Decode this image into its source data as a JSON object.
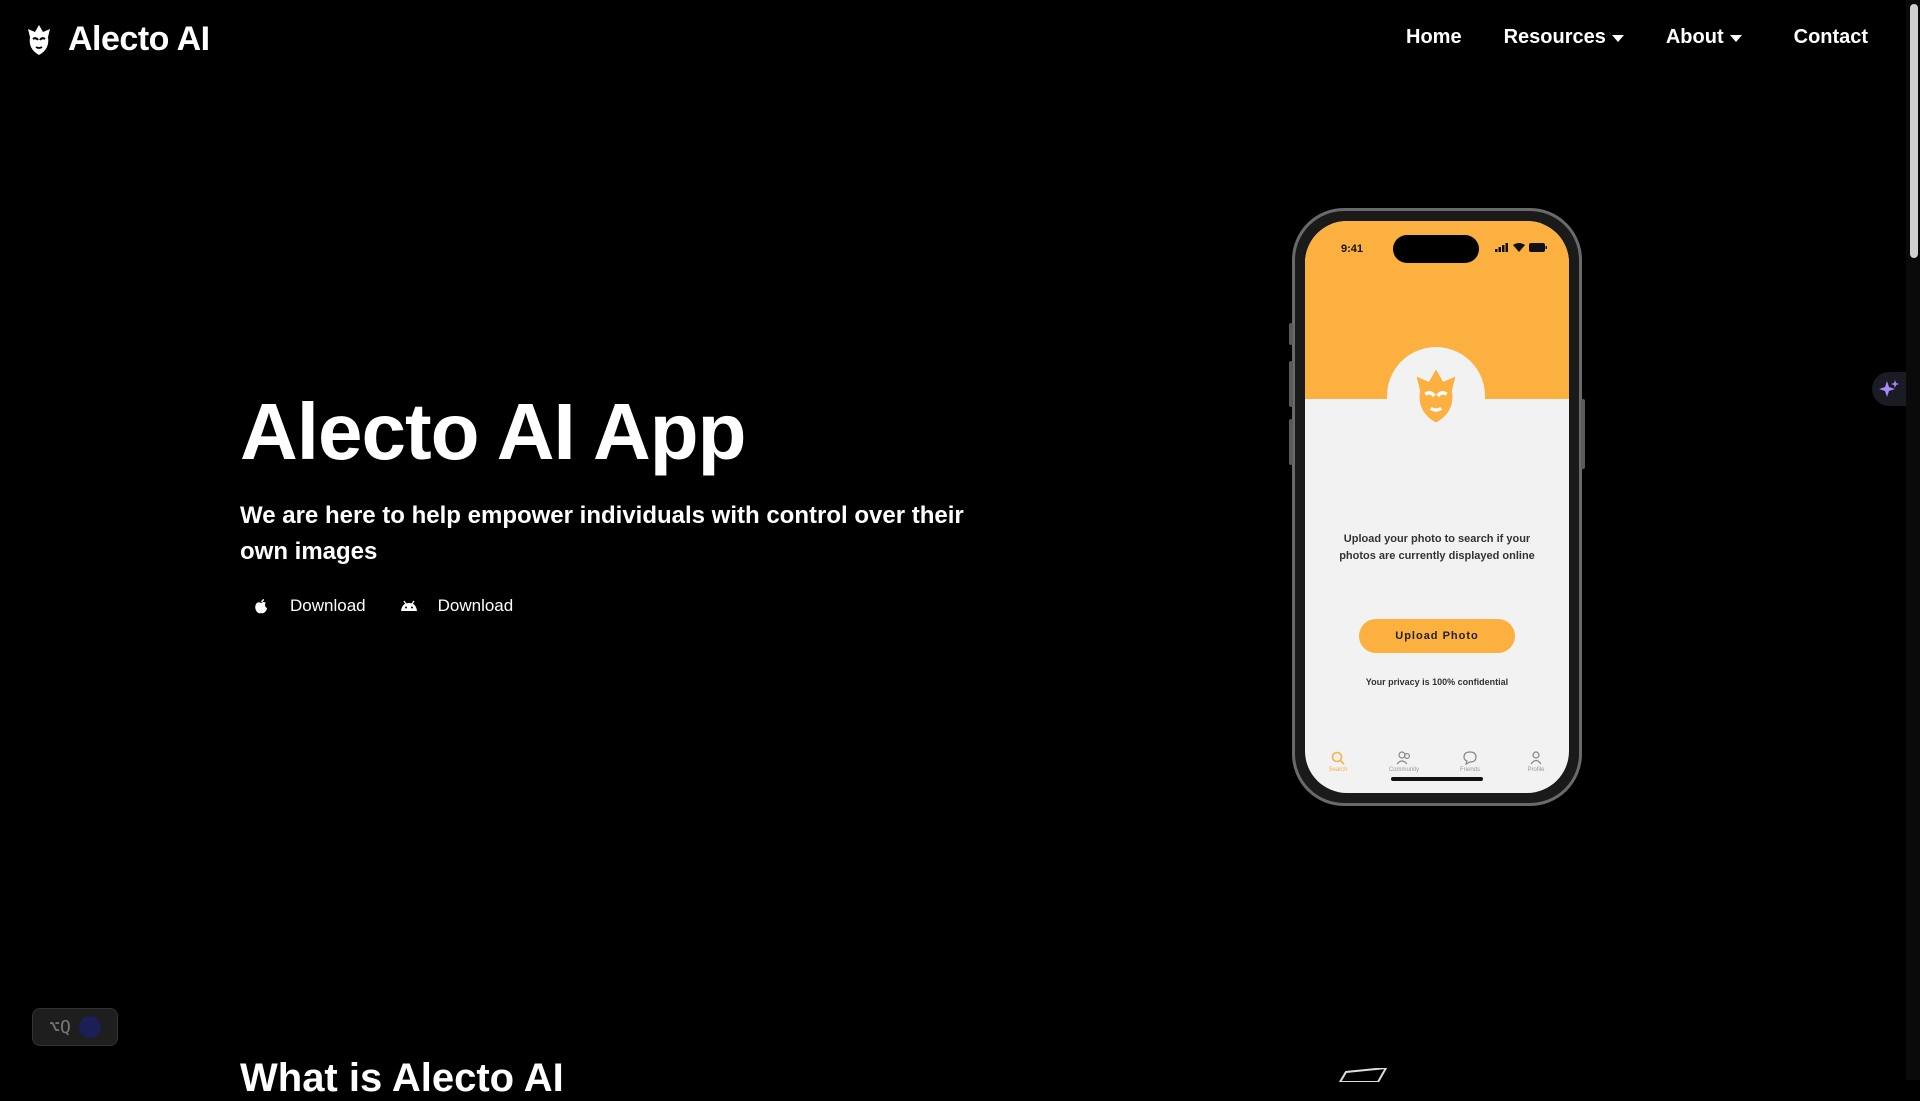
{
  "brand": {
    "name": "Alecto AI",
    "logo_icon": "alecto-face-logo-icon"
  },
  "nav": {
    "home": "Home",
    "resources": "Resources",
    "about": "About",
    "contact": "Contact"
  },
  "hero": {
    "title": "Alecto AI App",
    "subtitle": "We are here to help empower individuals with control over their own images",
    "downloads": [
      {
        "label": "Download",
        "icon": "apple-icon"
      },
      {
        "label": "Download",
        "icon": "android-icon"
      }
    ]
  },
  "phone": {
    "status_time": "9:41",
    "description": "Upload your photo to search if your photos are currently displayed online",
    "upload_button": "Upload Photo",
    "privacy_note": "Your privacy is 100% confidential",
    "tabs": [
      {
        "label": "Search",
        "icon": "search-icon",
        "active": true
      },
      {
        "label": "Community",
        "icon": "community-icon",
        "active": false
      },
      {
        "label": "Friends",
        "icon": "chat-icon",
        "active": false
      },
      {
        "label": "Profile",
        "icon": "profile-icon",
        "active": false
      }
    ],
    "accent_color": "#fbb040"
  },
  "next_section": {
    "title": "What is Alecto AI"
  },
  "widget": {
    "shortcut": "⌥Q"
  },
  "colors": {
    "background": "#000000",
    "text": "#ffffff",
    "accent": "#fbb040"
  }
}
